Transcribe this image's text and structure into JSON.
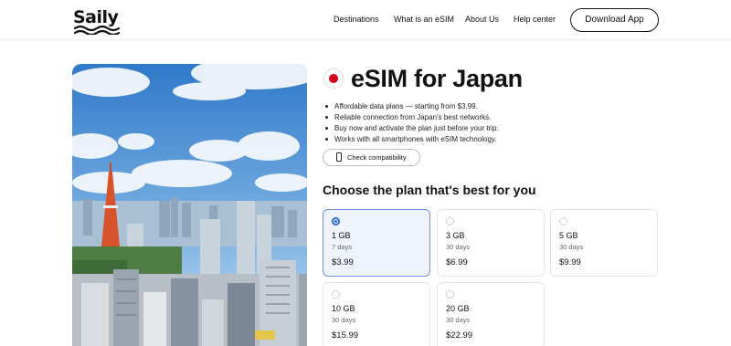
{
  "brand": {
    "logo_text": "Saily"
  },
  "nav": {
    "items": [
      "Destinations",
      "What is an eSIM",
      "About Us",
      "Help center"
    ],
    "download_label": "Download App"
  },
  "product": {
    "title": "eSIM for Japan",
    "flag_icon": "japan-flag-icon",
    "bullets": [
      "Affordable data plans — starting from $3.99.",
      "Reliable connection from Japan's best networks.",
      "Buy now and activate the plan just before your trip.",
      "Works with all smartphones with eSIM technology."
    ],
    "check_label": "Check compatibility",
    "plans_heading": "Choose the plan that's best for you"
  },
  "plans": [
    {
      "data": "1 GB",
      "duration": "7 days",
      "price": "$3.99",
      "selected": true
    },
    {
      "data": "3 GB",
      "duration": "30 days",
      "price": "$6.99",
      "selected": false
    },
    {
      "data": "5 GB",
      "duration": "30 days",
      "price": "$9.99",
      "selected": false
    },
    {
      "data": "10 GB",
      "duration": "30 days",
      "price": "$15.99",
      "selected": false
    },
    {
      "data": "20 GB",
      "duration": "30 days",
      "price": "$22.99",
      "selected": false
    }
  ],
  "colors": {
    "accent": "#2f63e0",
    "selected_bg": "#eef3fd",
    "flag_red": "#d4001b"
  }
}
